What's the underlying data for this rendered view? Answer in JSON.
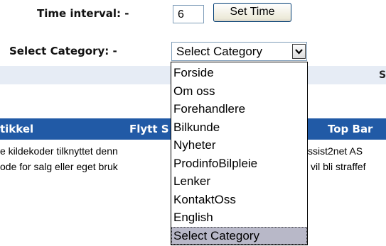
{
  "time_interval": {
    "label": "Time interval: -",
    "value": "6",
    "button_label": "Set Time"
  },
  "category": {
    "label": "Select Category: -",
    "selected": "Select Category",
    "options": [
      "Forside",
      "Om oss",
      "Forehandlere",
      "Bilkunde",
      "Nyheter",
      "ProdinfoBilpleie",
      "Lenker",
      "KontaktOss",
      "English",
      "Select Category"
    ],
    "highlighted_option": "Select Category"
  },
  "header_band": {
    "text": "S"
  },
  "table": {
    "columns": [
      "tikkel",
      "Flytt S",
      "Top Bar"
    ]
  },
  "body_lines": {
    "line1_left": "e kildekoder tilknyttet denn",
    "line1_right": "ssist2net AS",
    "line2_left": "ode for salg eller eget bruk",
    "line2_right": "vil bli straffef"
  },
  "colors": {
    "column_bar": "#215aa6",
    "header_band": "#e6ecf5",
    "selected_option": "#b8b8c8"
  }
}
